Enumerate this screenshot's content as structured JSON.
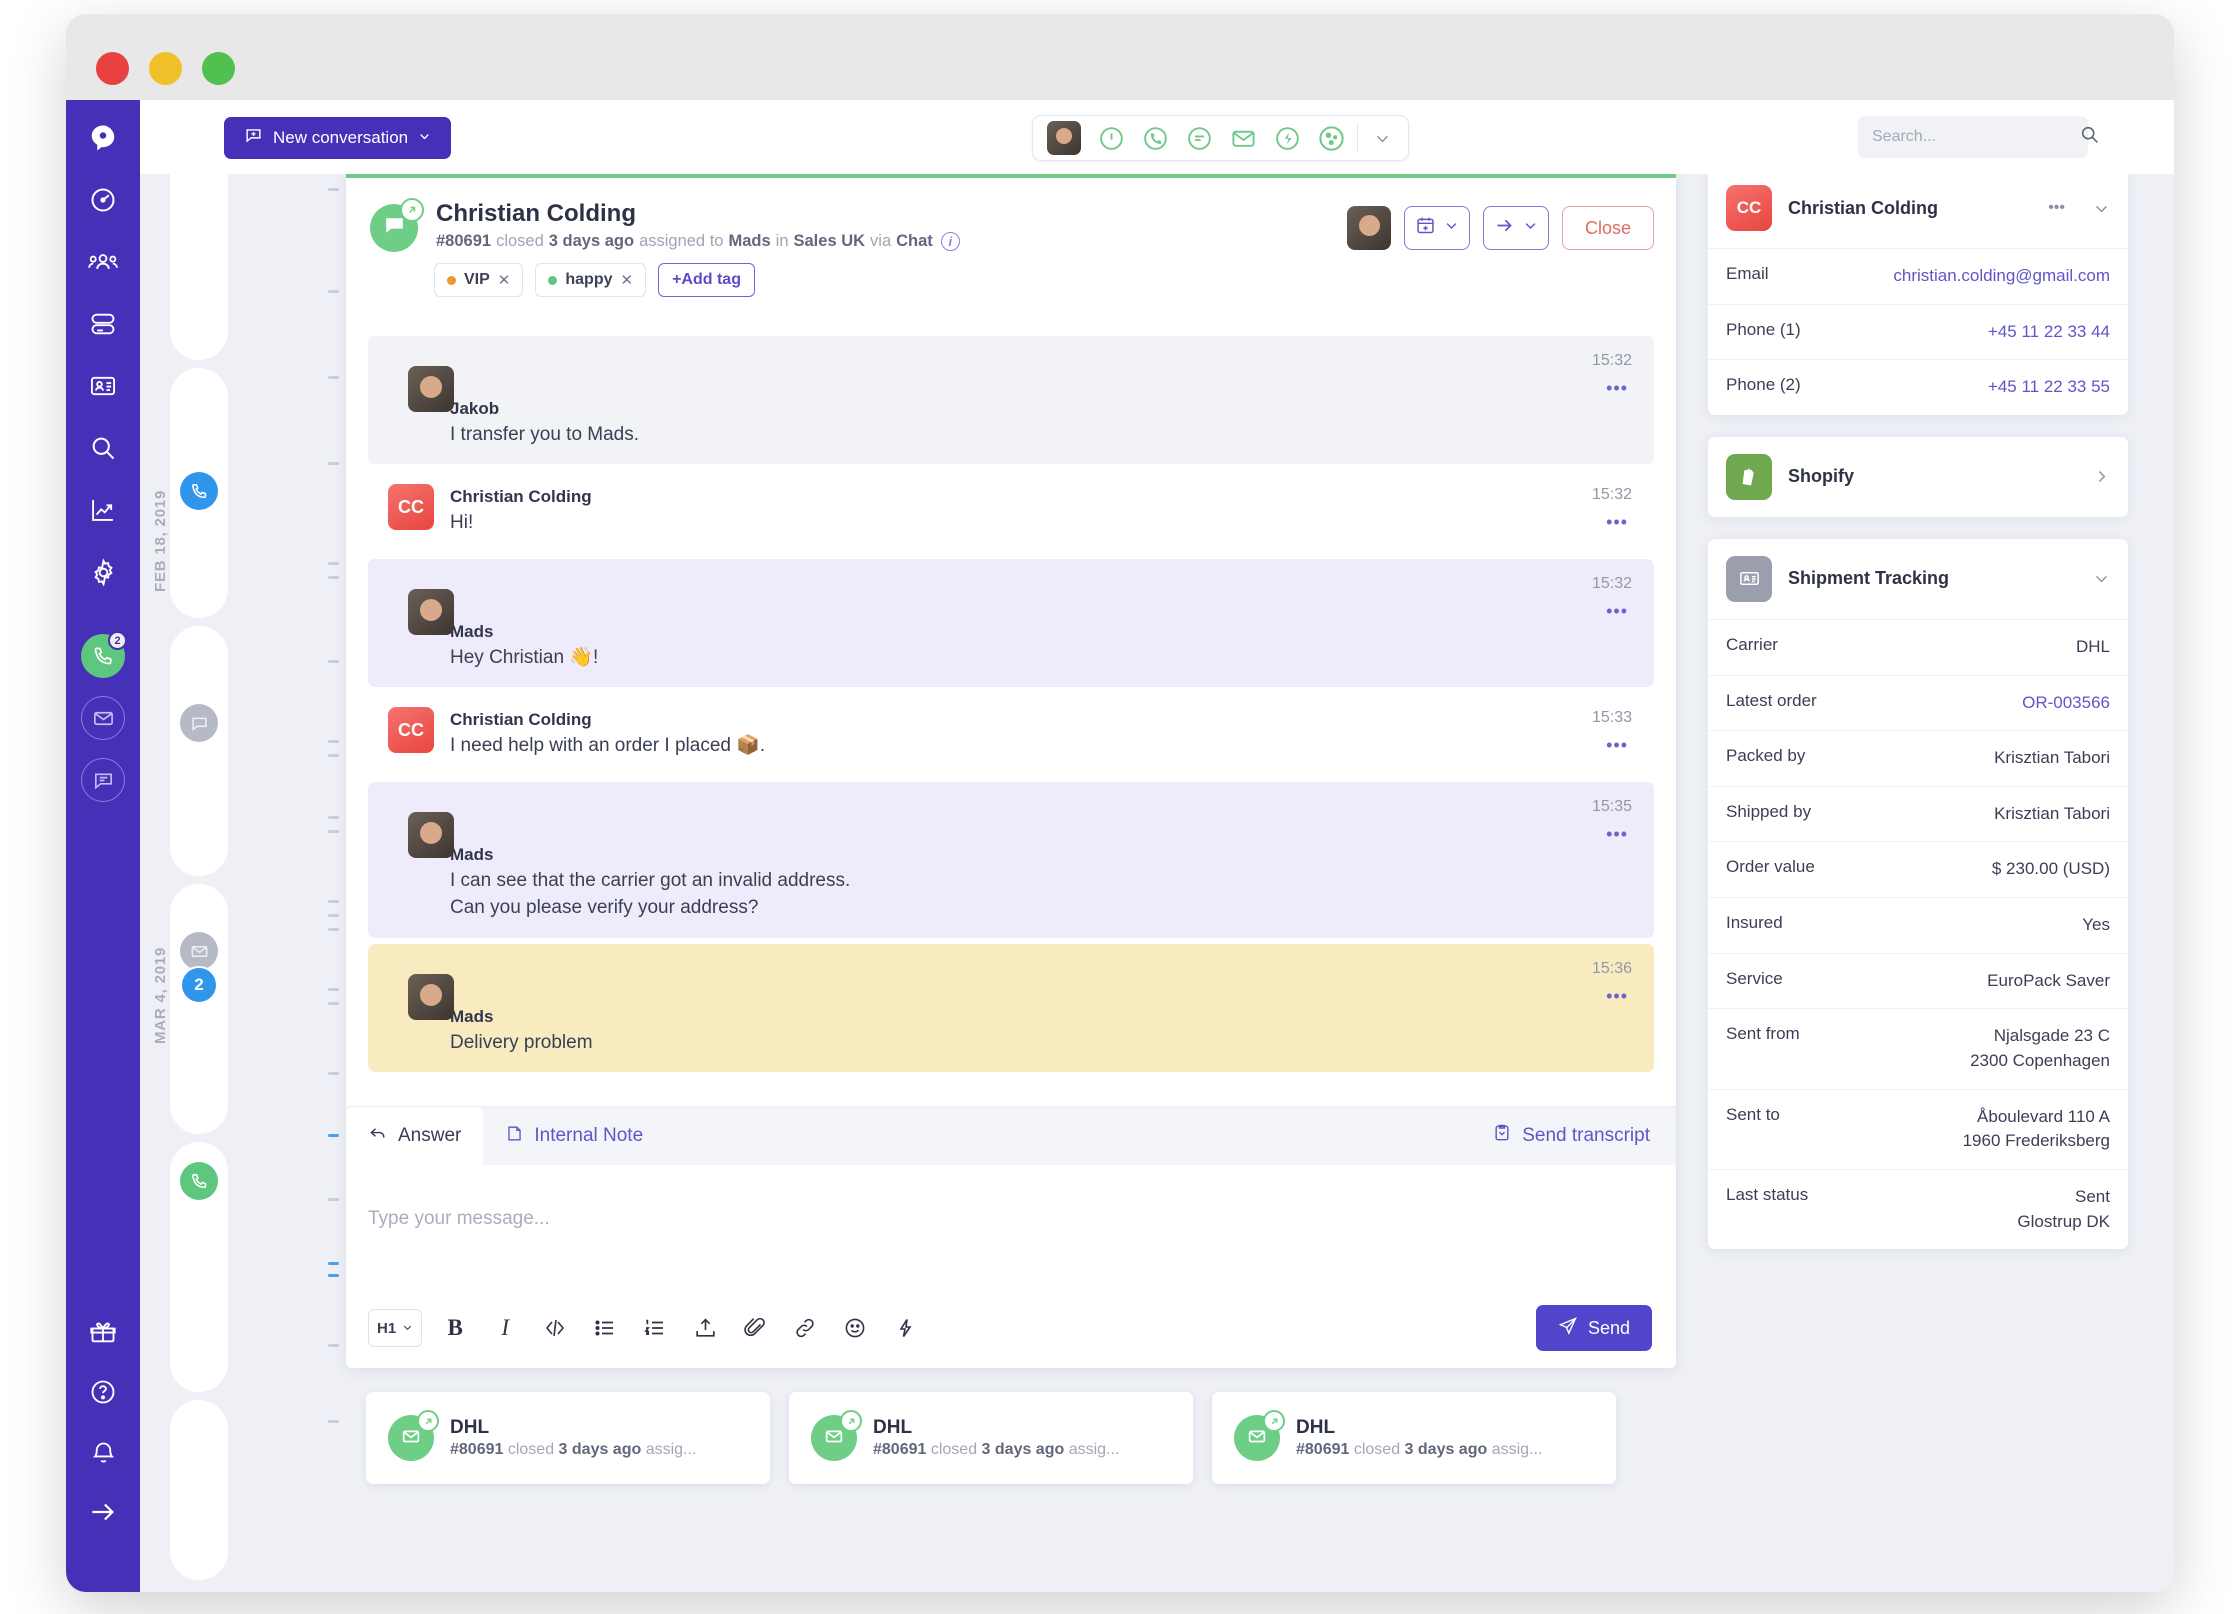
{
  "window": {
    "traffic_lights": [
      "close",
      "minimize",
      "maximize"
    ]
  },
  "topbar": {
    "new_conversation_label": "New conversation",
    "new_conversation_icon": "plus-bubble-icon",
    "channel_icons": [
      "agent-avatar",
      "pause-circle-icon",
      "phone-circle-icon",
      "chat-circle-icon",
      "mail-icon",
      "lightning-circle-icon",
      "social-circle-icon"
    ],
    "channel_caret_icon": "chevron-down-icon",
    "search": {
      "placeholder": "Search...",
      "value": "",
      "icon": "search-icon"
    }
  },
  "sidebar": {
    "items": [
      {
        "name": "logo",
        "icon": "puzzel-logo-icon"
      },
      {
        "name": "dashboard",
        "icon": "gauge-icon"
      },
      {
        "name": "teams",
        "icon": "people-icon"
      },
      {
        "name": "queues",
        "icon": "stack-icon"
      },
      {
        "name": "contacts",
        "icon": "contact-card-icon"
      },
      {
        "name": "search",
        "icon": "search-icon"
      },
      {
        "name": "statistics",
        "icon": "chart-up-icon"
      },
      {
        "name": "settings",
        "icon": "gear-icon"
      }
    ],
    "channels": [
      {
        "name": "phone",
        "icon": "phone-icon",
        "active": true,
        "badge": "2"
      },
      {
        "name": "email",
        "icon": "mail-icon",
        "active": false,
        "badge": ""
      },
      {
        "name": "chat",
        "icon": "chat-icon",
        "active": false,
        "badge": ""
      }
    ],
    "bottom_items": [
      {
        "name": "gifts",
        "icon": "gift-icon"
      },
      {
        "name": "help",
        "icon": "question-circle-icon"
      },
      {
        "name": "notifications",
        "icon": "bell-icon"
      },
      {
        "name": "collapse",
        "icon": "arrow-right-icon"
      }
    ]
  },
  "minilist": {
    "date_labels": [
      "FEB 18, 2019",
      "MAR 4, 2019"
    ],
    "items": [
      {
        "icon": "chat-icon",
        "state": "muted",
        "badge": ""
      },
      {
        "icon": "phone-icon",
        "state": "active-blue",
        "badge": ""
      },
      {
        "icon": "chat-icon",
        "state": "muted",
        "badge": ""
      },
      {
        "icon": "mail-icon",
        "state": "muted",
        "badge": "2"
      },
      {
        "icon": "phone-icon",
        "state": "green",
        "badge": ""
      }
    ]
  },
  "conversation": {
    "avatar_icon": "chat-outbound-icon",
    "title": "Christian Colding",
    "meta": {
      "ticket_id": "#80691",
      "status_word": "closed",
      "time_ago": "3 days ago",
      "assigned_label": "assigned to",
      "assignee": "Mads",
      "in_label": "in",
      "team": "Sales UK",
      "via_label": "via",
      "channel": "Chat",
      "info_icon": "info-icon"
    },
    "tags": [
      {
        "label": "VIP",
        "color": "#f0962e",
        "close_icon": "close-icon"
      },
      {
        "label": "happy",
        "color": "#5ec77f",
        "close_icon": "close-icon"
      }
    ],
    "add_tag_label": "+Add tag",
    "actions": {
      "assignee_avatar": "agent-avatar",
      "schedule_icon": "calendar-plus-icon",
      "schedule_caret": "chevron-down-icon",
      "forward_icon": "arrow-right-icon",
      "forward_caret": "chevron-down-icon",
      "close_label": "Close"
    },
    "messages": [
      {
        "author": "Jakob",
        "avatar": "photo",
        "text": "I transfer you to Mads.",
        "time": "15:32",
        "bg": "grey",
        "more_icon": "more-icon"
      },
      {
        "author": "Christian Colding",
        "avatar": "cc",
        "text": "Hi!",
        "time": "15:32",
        "bg": "white",
        "more_icon": "more-icon"
      },
      {
        "author": "Mads",
        "avatar": "photo",
        "text": "Hey Christian 👋!",
        "time": "15:32",
        "bg": "purple",
        "more_icon": "more-icon"
      },
      {
        "author": "Christian Colding",
        "avatar": "cc",
        "text": "I need help with an order I placed 📦.",
        "time": "15:33",
        "bg": "white",
        "more_icon": "more-icon"
      },
      {
        "author": "Mads",
        "avatar": "photo",
        "text": "I can see that the carrier got an invalid address.\nCan you please verify your address?",
        "time": "15:35",
        "bg": "purple",
        "more_icon": "more-icon"
      },
      {
        "author": "Mads",
        "avatar": "photo",
        "text": "Delivery problem",
        "time": "15:36",
        "bg": "yellow",
        "more_icon": "more-icon"
      }
    ]
  },
  "composer": {
    "tabs": [
      {
        "label": "Answer",
        "icon": "reply-icon",
        "active": true
      },
      {
        "label": "Internal Note",
        "icon": "note-icon",
        "active": false
      }
    ],
    "send_transcript_label": "Send transcript",
    "send_transcript_icon": "transcript-icon",
    "input_placeholder": "Type your message...",
    "input_value": "",
    "heading_select": "H1",
    "heading_caret_icon": "chevron-down-icon",
    "tools": [
      {
        "name": "bold",
        "icon": "bold-icon",
        "glyph": "B"
      },
      {
        "name": "italic",
        "icon": "italic-icon",
        "glyph": "I"
      },
      {
        "name": "code",
        "icon": "code-icon",
        "glyph": "</>"
      },
      {
        "name": "bulleted-list",
        "icon": "bulleted-list-icon",
        "glyph": ""
      },
      {
        "name": "numbered-list",
        "icon": "numbered-list-icon",
        "glyph": ""
      },
      {
        "name": "upload",
        "icon": "upload-icon",
        "glyph": ""
      },
      {
        "name": "attachment",
        "icon": "paperclip-icon",
        "glyph": ""
      },
      {
        "name": "link",
        "icon": "link-icon",
        "glyph": ""
      },
      {
        "name": "emoji",
        "icon": "emoji-icon",
        "glyph": ""
      },
      {
        "name": "shortcut",
        "icon": "lightning-icon",
        "glyph": ""
      }
    ],
    "send_label": "Send",
    "send_icon": "paper-plane-icon"
  },
  "bottom_cards": [
    {
      "title": "DHL",
      "icon": "mail-outbound-icon",
      "ticket_id": "#80691",
      "status_word": "closed",
      "time_ago": "3 days ago",
      "tail": "assig..."
    },
    {
      "title": "DHL",
      "icon": "mail-outbound-icon",
      "ticket_id": "#80691",
      "status_word": "closed",
      "time_ago": "3 days ago",
      "tail": "assig..."
    },
    {
      "title": "DHL",
      "icon": "mail-outbound-icon",
      "ticket_id": "#80691",
      "status_word": "closed",
      "time_ago": "3 days ago",
      "tail": "assig..."
    }
  ],
  "right_panel": {
    "contact": {
      "avatar_initials": "CC",
      "name": "Christian Colding",
      "more_icon": "more-icon",
      "collapse_icon": "chevron-down-icon",
      "rows": [
        {
          "key": "Email",
          "value": "christian.colding@gmail.com",
          "link": true
        },
        {
          "key": "Phone (1)",
          "value": "+45 11 22 33 44",
          "link": true
        },
        {
          "key": "Phone (2)",
          "value": "+45 11 22 33 55",
          "link": true
        }
      ]
    },
    "shopify": {
      "title": "Shopify",
      "icon": "shopify-icon",
      "chevron_icon": "chevron-right-icon"
    },
    "shipment": {
      "title": "Shipment Tracking",
      "icon": "shipment-card-icon",
      "collapse_icon": "chevron-down-icon",
      "rows": [
        {
          "key": "Carrier",
          "value": "DHL",
          "value2": "",
          "link": false
        },
        {
          "key": "Latest order",
          "value": "OR-003566",
          "value2": "",
          "link": true
        },
        {
          "key": "Packed by",
          "value": "Krisztian Tabori",
          "value2": "",
          "link": false
        },
        {
          "key": "Shipped by",
          "value": "Krisztian Tabori",
          "value2": "",
          "link": false
        },
        {
          "key": "Order value",
          "value": "$ 230.00 (USD)",
          "value2": "",
          "link": false
        },
        {
          "key": "Insured",
          "value": "Yes",
          "value2": "",
          "link": false
        },
        {
          "key": "Service",
          "value": "EuroPack Saver",
          "value2": "",
          "link": false
        },
        {
          "key": "Sent from",
          "value": "Njalsgade 23 C",
          "value2": "2300 Copenhagen",
          "link": false
        },
        {
          "key": "Sent to",
          "value": "Åboulevard 110 A",
          "value2": "1960 Frederiksberg",
          "link": false
        },
        {
          "key": "Last status",
          "value": "Sent",
          "value2": "Glostrup DK",
          "link": false
        }
      ]
    }
  },
  "colors": {
    "brand_purple": "#4530b8",
    "accent_purple": "#5245cc",
    "green": "#6ece85",
    "red": "#e8453f",
    "yellow_highlight": "#f9ebc0",
    "purple_highlight": "#eeecfb"
  }
}
